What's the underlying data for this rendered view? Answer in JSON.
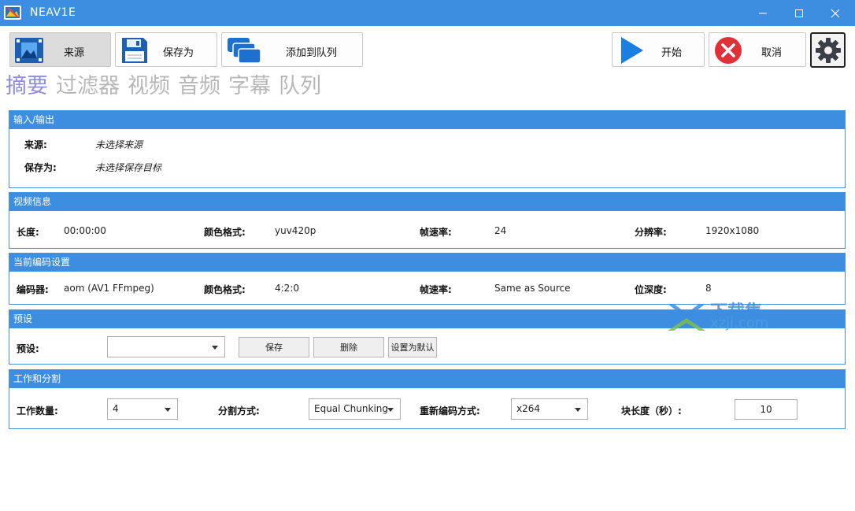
{
  "window": {
    "title": "NEAV1E"
  },
  "toolbar": {
    "source_label": "来源",
    "saveas_label": "保存为",
    "queue_label": "添加到队列",
    "start_label": "开始",
    "cancel_label": "取消"
  },
  "tabs": [
    {
      "label": "摘要",
      "active": true
    },
    {
      "label": "过滤器"
    },
    {
      "label": "视频"
    },
    {
      "label": "音频"
    },
    {
      "label": "字幕"
    },
    {
      "label": "队列"
    }
  ],
  "io": {
    "title": "输入/输出",
    "source_label": "来源:",
    "source_value": "未选择来源",
    "saveas_label": "保存为:",
    "saveas_value": "未选择保存目标"
  },
  "video_info": {
    "title": "视频信息",
    "length_label": "长度:",
    "length_value": "00:00:00",
    "color_label": "颜色格式:",
    "color_value": "yuv420p",
    "fps_label": "帧速率:",
    "fps_value": "24",
    "res_label": "分辨率:",
    "res_value": "1920x1080"
  },
  "encoder": {
    "title": "当前编码设置",
    "encoder_label": "编码器:",
    "encoder_value": "aom (AV1 FFmpeg)",
    "color_label": "颜色格式:",
    "color_value": "4:2:0",
    "fps_label": "帧速率:",
    "fps_value": "Same as Source",
    "depth_label": "位深度:",
    "depth_value": "8"
  },
  "preset": {
    "title": "预设",
    "label": "预设:",
    "selected": "",
    "save_label": "保存",
    "delete_label": "删除",
    "default_label": "设置为默认"
  },
  "work": {
    "title": "工作和分割",
    "workers_label": "工作数量:",
    "workers_value": "4",
    "split_label": "分割方式:",
    "split_value": "Equal Chunking",
    "reencode_label": "重新编码方式:",
    "reencode_value": "x264",
    "chunk_label": "块长度（秒）:",
    "chunk_value": "10"
  },
  "watermark": {
    "cn": "下载集",
    "en": "xzji.com"
  },
  "colors": {
    "accent": "#3d8ee0",
    "tab_active": "#8c8ed8",
    "tab_inactive": "#b7b7b7",
    "cancel_red": "#e0303a",
    "start_blue": "#1a7fe0"
  }
}
